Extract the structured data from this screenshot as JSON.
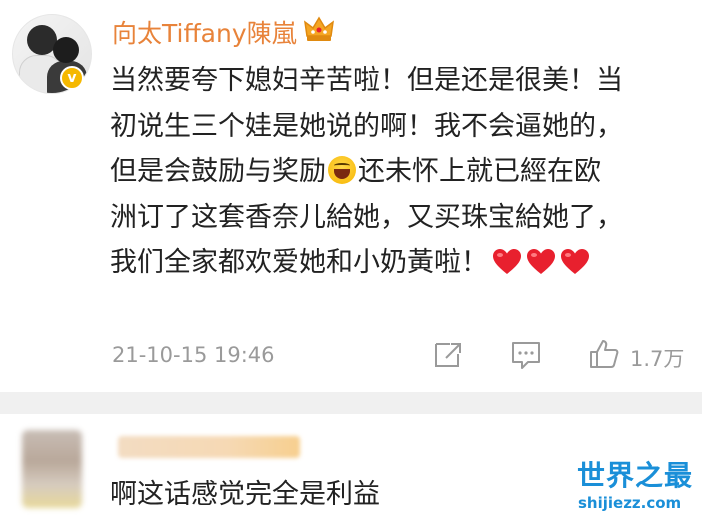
{
  "post": {
    "username": "向太Tiffany陳嵐",
    "text_lines": [
      "当然要夸下媳妇辛苦啦！但是还是很美！当",
      "初说生三个娃是她说的啊！我不会逼她的，",
      "但是会鼓励与奖励",
      "还未怀上就已經在欧",
      "洲订了这套香奈儿給她，又买珠宝給她了，",
      "我们全家都欢爱她和小奶黃啦！"
    ],
    "timestamp": "21-10-15 19:46",
    "like_count": "1.7万",
    "inline_emoji": "laughing-emoji",
    "hearts": 3
  },
  "reply": {
    "text": "啊这话感觉完全是利益"
  },
  "watermark": {
    "site_name": "世界之最",
    "site_url": "shijiezz.com"
  },
  "colors": {
    "username": "#e8833a",
    "meta": "#9a9a9a",
    "heart": "#e8202e",
    "logo": "#1a8fd8",
    "divider": "#f0f0f0"
  }
}
